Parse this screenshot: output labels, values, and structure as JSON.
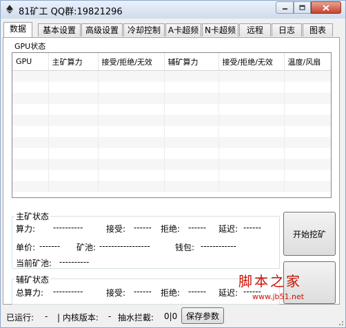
{
  "window": {
    "title": "81矿工  QQ群:19821296"
  },
  "tabs": [
    "数据",
    "基本设置",
    "高级设置",
    "冷却控制",
    "A卡超频",
    "N卡超频",
    "远程",
    "日志",
    "图表"
  ],
  "gpu_status": {
    "label": "GPU状态",
    "columns": [
      "GPU",
      "主矿算力",
      "接受/拒绝/无效",
      "辅矿算力",
      "接受/拒绝/无效",
      "温度/风扇"
    ]
  },
  "main_status": {
    "title": "主矿状态",
    "hashrate_label": "算力:",
    "hashrate_value": "----------",
    "accepted_label": "接受:",
    "accepted_value": "------",
    "rejected_label": "拒绝:",
    "rejected_value": "------",
    "latency_label": "延迟:",
    "latency_value": "------",
    "price_label": "单价:",
    "price_value": "-------",
    "pool_label": "矿池:",
    "pool_value": "-----------------",
    "wallet_label": "钱包:",
    "wallet_value": "------------",
    "current_pool_label": "当前矿池:",
    "current_pool_value": "----------"
  },
  "aux_status": {
    "title": "辅矿状态",
    "total_hashrate_label": "总算力:",
    "total_hashrate_value": "----------",
    "accepted_label": "接受:",
    "accepted_value": "------",
    "rejected_label": "拒绝:",
    "rejected_value": "------",
    "latency_label": "延迟:",
    "latency_value": "------"
  },
  "buttons": {
    "start_mining": "开始挖矿",
    "save": "保存参数"
  },
  "statusbar": {
    "running_label": "已运行:",
    "running_value": "-",
    "kernel_label": "| 内核版本:",
    "kernel_value": "-",
    "devfee_label": "抽水拦截:",
    "devfee_value": "0|0"
  },
  "watermark": {
    "main": "脚本之家",
    "sub": "www.jb51.net"
  },
  "colors": {
    "titlebar": "#dae5f3",
    "close_button": "#c7432c",
    "watermark": "#cc1100"
  }
}
